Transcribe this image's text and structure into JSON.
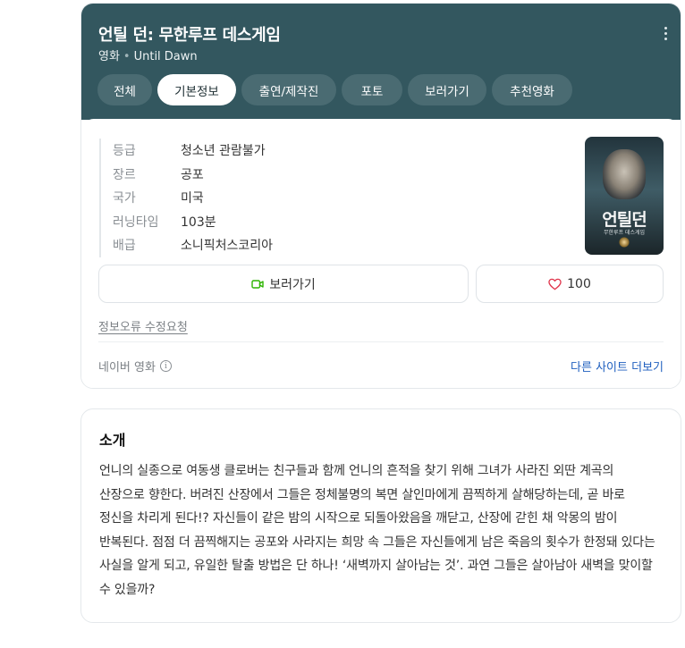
{
  "header": {
    "title": "언틸 던: 무한루프 데스게임",
    "category": "영화",
    "english_title": "Until Dawn",
    "more_icon": "more-vertical-icon",
    "background_color": "#33575f"
  },
  "tabs": [
    {
      "label": "전체",
      "active": false
    },
    {
      "label": "기본정보",
      "active": true
    },
    {
      "label": "출연/제작진",
      "active": false
    },
    {
      "label": "포토",
      "active": false
    },
    {
      "label": "보러가기",
      "active": false
    },
    {
      "label": "추천영화",
      "active": false
    }
  ],
  "info": {
    "rows": [
      {
        "key": "등급",
        "value": "청소년 관람불가"
      },
      {
        "key": "장르",
        "value": "공포"
      },
      {
        "key": "국가",
        "value": "미국"
      },
      {
        "key": "러닝타임",
        "value": "103분"
      },
      {
        "key": "배급",
        "value": "소니픽처스코리아"
      }
    ]
  },
  "poster": {
    "title": "언틸던",
    "subtitle": "무한루프 데스게임"
  },
  "actions": {
    "watch_label": "보러가기",
    "watch_icon": "video-camera-icon",
    "like_icon": "heart-icon",
    "like_count": "100",
    "accent_green": "#2db400",
    "accent_red": "#e0344b"
  },
  "report_link": "정보오류 수정요청",
  "source": {
    "label": "네이버 영화",
    "more_sites": "다른 사이트 더보기"
  },
  "intro": {
    "heading": "소개",
    "text": "언니의 실종으로 여동생 클로버는 친구들과 함께 언니의 흔적을 찾기 위해 그녀가 사라진 외딴 계곡의 산장으로 향한다. 버려진 산장에서 그들은 정체불명의 복면 살인마에게 끔찍하게 살해당하는데, 곧 바로 정신을 차리게 된다!? 자신들이 같은 밤의 시작으로 되돌아왔음을 깨닫고, 산장에 갇힌 채 악몽의 밤이 반복된다. 점점 더 끔찍해지는 공포와 사라지는 희망 속 그들은 자신들에게 남은 죽음의 횟수가 한정돼 있다는 사실을 알게 되고, 유일한 탈출 방법은 단 하나! ‘새벽까지 살아남는 것’. 과연 그들은 살아남아 새벽을 맞이할 수 있을까?"
  }
}
